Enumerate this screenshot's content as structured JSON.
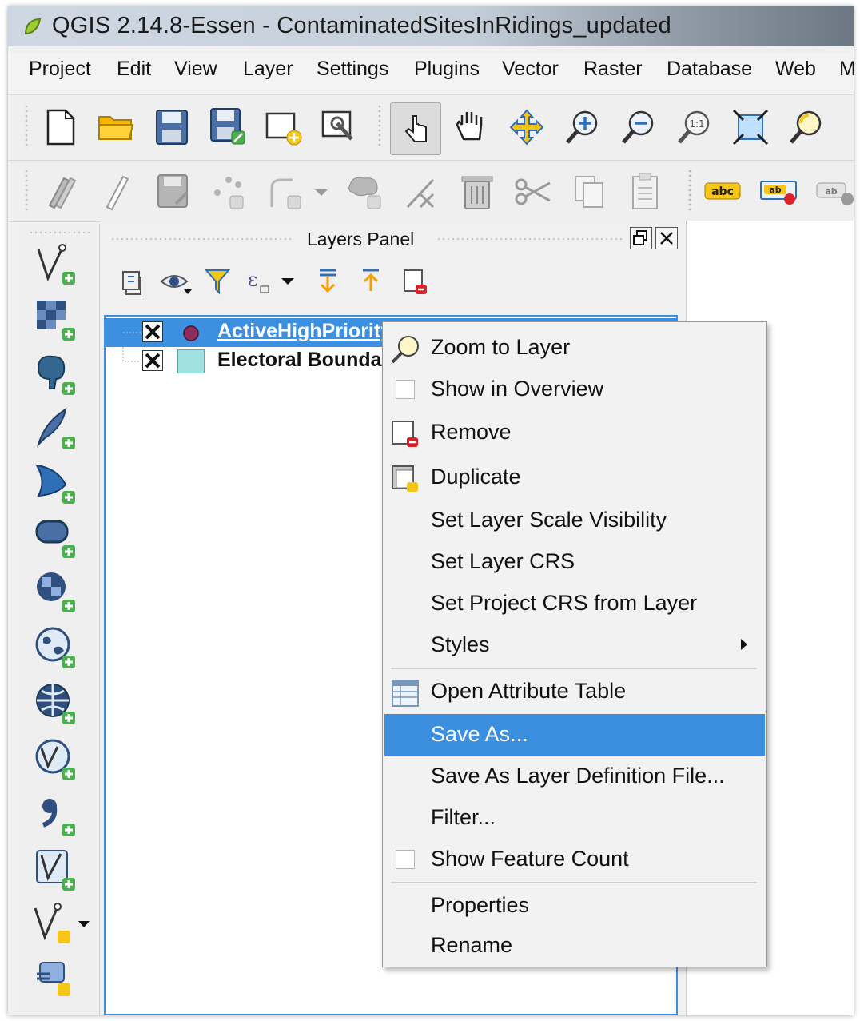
{
  "window": {
    "title": "QGIS 2.14.8-Essen - ContaminatedSitesInRidings_updated"
  },
  "menubar": {
    "items": [
      "Project",
      "Edit",
      "View",
      "Layer",
      "Settings",
      "Plugins",
      "Vector",
      "Raster",
      "Database",
      "Web",
      "M"
    ]
  },
  "layers_panel": {
    "title": "Layers Panel",
    "layers": [
      {
        "name": "ActiveHighPriorityFi",
        "visible": true,
        "selected": true,
        "symbol": "point",
        "symbol_color": "#8b2e5a"
      },
      {
        "name": "Electoral Bounda",
        "visible": true,
        "selected": false,
        "symbol": "polygon",
        "symbol_color": "#9fe2de"
      }
    ]
  },
  "toolbar2": {
    "label_tool": "abc",
    "label_tool2": "ab"
  },
  "context_menu": {
    "items": [
      {
        "label": "Zoom to Layer",
        "icon": "zoom-to-layer-icon"
      },
      {
        "label": "Show in Overview",
        "checkbox": true
      },
      {
        "label": "Remove",
        "icon": "remove-layer-icon"
      },
      {
        "label": "Duplicate",
        "icon": "duplicate-layer-icon"
      },
      {
        "label": "Set Layer Scale Visibility"
      },
      {
        "label": "Set Layer CRS"
      },
      {
        "label": "Set Project CRS from Layer"
      },
      {
        "label": "Styles",
        "submenu": true
      },
      {
        "label": "Open Attribute Table",
        "icon": "attribute-table-icon"
      },
      {
        "label": "Save As...",
        "highlighted": true
      },
      {
        "label": "Save As Layer Definition File..."
      },
      {
        "label": "Filter..."
      },
      {
        "label": "Show Feature Count",
        "checkbox": true
      },
      {
        "label": "Properties"
      },
      {
        "label": "Rename"
      }
    ]
  },
  "colors": {
    "selection": "#3b8fde",
    "icon_green": "#4caf50",
    "icon_yellow": "#f5c518",
    "icon_blue": "#2f6fb7"
  }
}
